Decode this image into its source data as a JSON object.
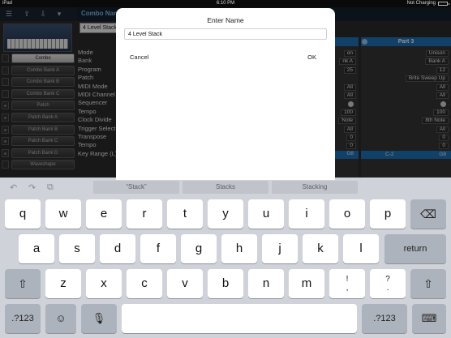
{
  "status_bar": {
    "device": "iPad",
    "time": "6:10 PM",
    "charging": "Not Charging"
  },
  "app": {
    "combo_name_label": "Combo Name",
    "combo_name_value": "4 Level Stack",
    "left_list": [
      {
        "label": "Combo",
        "selected": true
      },
      {
        "label": "Combo Bank A"
      },
      {
        "label": "Combo Bank B"
      },
      {
        "label": "Combo Bank C"
      },
      {
        "label": "Patch"
      },
      {
        "label": "Patch Bank A"
      },
      {
        "label": "Patch Bank B"
      },
      {
        "label": "Patch Bank C"
      },
      {
        "label": "Patch Bank D"
      },
      {
        "label": "Waveshape"
      }
    ],
    "params": [
      "Mode",
      "Bank",
      "Program",
      "Patch",
      "MIDI Mode",
      "MIDI Channel",
      "Sequencer",
      "Tempo",
      "Clock Divide",
      "Trigger Select",
      "Transpose",
      "Tempo",
      "Key Range (L)"
    ],
    "part_col_a": [
      "on",
      "nk A",
      "25",
      "",
      "All",
      "All",
      "",
      "100",
      "Note",
      "All",
      "0",
      "0",
      "G8"
    ],
    "part3": {
      "title": "Part 3",
      "values": [
        "Unison",
        "Bank A",
        "12",
        "Brite Sweep Up",
        "All",
        "All",
        "",
        "100",
        "8th Note",
        "All",
        "0",
        "0"
      ],
      "range_low": "C-2",
      "range_high": "G8"
    }
  },
  "dialog": {
    "title": "Enter Name",
    "input_value": "4 Level Stack",
    "cancel_label": "Cancel",
    "ok_label": "OK"
  },
  "keyboard": {
    "suggestions": [
      "“Stack”",
      "Stacks",
      "Stacking"
    ],
    "row1": [
      "q",
      "w",
      "e",
      "r",
      "t",
      "y",
      "u",
      "i",
      "o",
      "p"
    ],
    "row2": [
      "a",
      "s",
      "d",
      "f",
      "g",
      "h",
      "j",
      "k",
      "l"
    ],
    "row3": [
      "z",
      "x",
      "c",
      "v",
      "b",
      "n",
      "m"
    ],
    "punct1_top": "!",
    "punct1_bottom": ",",
    "punct2_top": "?",
    "punct2_bottom": ".",
    "return_label": "return",
    "numbers_label": ".?123",
    "icons": {
      "undo": "undo-icon",
      "redo": "redo-icon",
      "paste": "paste-icon",
      "backspace": "backspace-icon",
      "shift": "shift-icon",
      "emoji": "emoji-icon",
      "mic": "mic-icon",
      "hide": "keyboard-hide-icon"
    }
  }
}
